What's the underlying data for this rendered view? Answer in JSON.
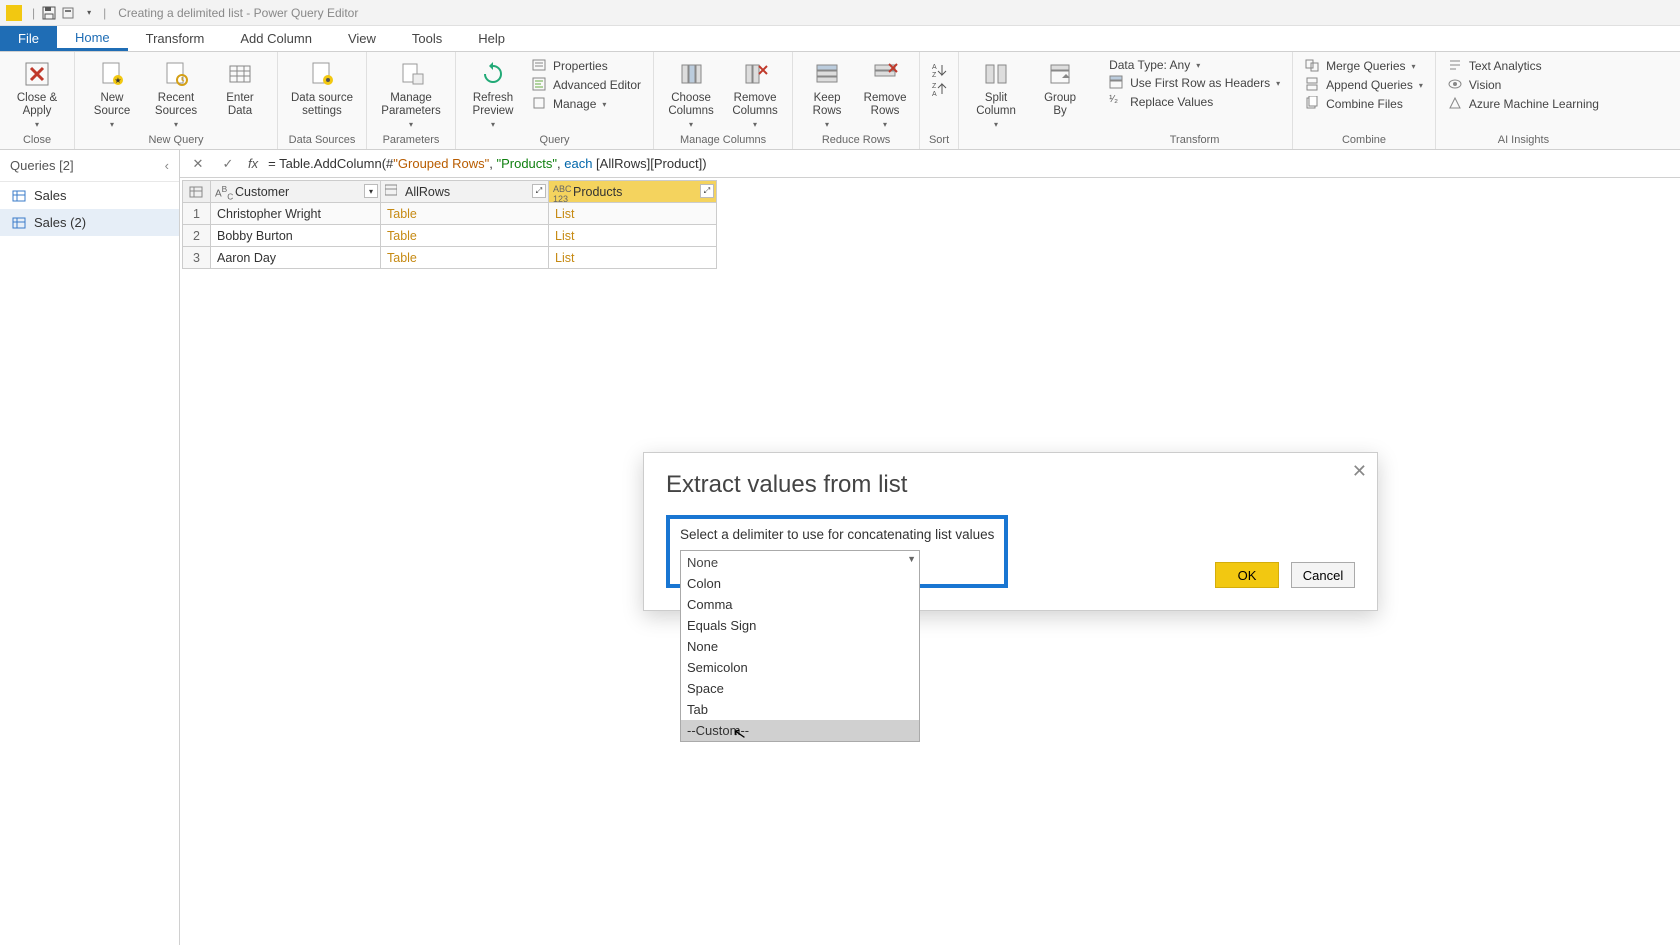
{
  "titlebar": {
    "app_name": "Creating a delimited list - Power Query Editor"
  },
  "tabs": {
    "file": "File",
    "home": "Home",
    "transform": "Transform",
    "add_column": "Add Column",
    "view": "View",
    "tools": "Tools",
    "help": "Help"
  },
  "ribbon": {
    "close": {
      "close_apply": "Close &\nApply",
      "group": "Close"
    },
    "new_query": {
      "new_source": "New\nSource",
      "recent_sources": "Recent\nSources",
      "enter_data": "Enter\nData",
      "group": "New Query"
    },
    "data_sources": {
      "settings": "Data source\nsettings",
      "group": "Data Sources"
    },
    "parameters": {
      "manage": "Manage\nParameters",
      "group": "Parameters"
    },
    "query": {
      "refresh": "Refresh\nPreview",
      "properties": "Properties",
      "advanced": "Advanced Editor",
      "manage": "Manage",
      "group": "Query"
    },
    "manage_columns": {
      "choose": "Choose\nColumns",
      "remove": "Remove\nColumns",
      "group": "Manage Columns"
    },
    "reduce_rows": {
      "keep": "Keep\nRows",
      "remove": "Remove\nRows",
      "group": "Reduce Rows"
    },
    "sort": {
      "group": "Sort"
    },
    "split": {
      "split": "Split\nColumn",
      "groupby": "Group\nBy"
    },
    "transform": {
      "data_type": "Data Type: Any",
      "first_row": "Use First Row as Headers",
      "replace": "Replace Values",
      "group": "Transform"
    },
    "combine": {
      "merge": "Merge Queries",
      "append": "Append Queries",
      "combine_files": "Combine Files",
      "group": "Combine"
    },
    "ai": {
      "text": "Text Analytics",
      "vision": "Vision",
      "ml": "Azure Machine Learning",
      "group": "AI Insights"
    }
  },
  "queries": {
    "header": "Queries [2]",
    "items": [
      "Sales",
      "Sales (2)"
    ]
  },
  "formula": {
    "prefix": "= Table.AddColumn(#",
    "arg1": "\"Grouped Rows\"",
    "sep1": ", ",
    "arg2": "\"Products\"",
    "sep2": ", ",
    "kw": "each",
    "rest": " [AllRows][Product])"
  },
  "grid": {
    "columns": [
      "Customer",
      "AllRows",
      "Products"
    ],
    "rows": [
      {
        "n": "1",
        "customer": "Christopher Wright",
        "allrows": "Table",
        "products": "List"
      },
      {
        "n": "2",
        "customer": "Bobby Burton",
        "allrows": "Table",
        "products": "List"
      },
      {
        "n": "3",
        "customer": "Aaron Day",
        "allrows": "Table",
        "products": "List"
      }
    ]
  },
  "dialog": {
    "title": "Extract values from list",
    "prompt": "Select a delimiter to use for concatenating list values",
    "selected": "None",
    "options": [
      "Colon",
      "Comma",
      "Equals Sign",
      "None",
      "Semicolon",
      "Space",
      "Tab",
      "--Custom--"
    ],
    "ok": "OK",
    "cancel": "Cancel"
  }
}
